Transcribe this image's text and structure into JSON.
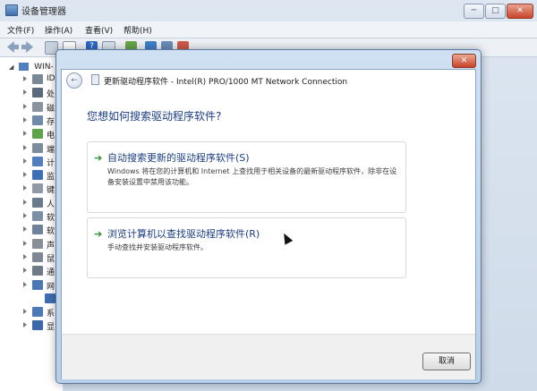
{
  "background_window": {
    "title": "设备管理器",
    "controls": {
      "minimize": "─",
      "maximize": "□",
      "close": "✕"
    },
    "menu": [
      "文件(F)",
      "操作(A)",
      "查看(V)",
      "帮助(H)"
    ],
    "toolbar_help": "?",
    "tree": {
      "root_label": "WIN-",
      "root_expander": "◢",
      "items": [
        {
          "label": "ID",
          "icon": "ide-controller-icon",
          "color": "#7a8796"
        },
        {
          "label": "处",
          "icon": "processor-icon",
          "color": "#5a6a7c"
        },
        {
          "label": "磁",
          "icon": "disk-drive-icon",
          "color": "#8a949f"
        },
        {
          "label": "存",
          "icon": "storage-controller-icon",
          "color": "#6f8aa8"
        },
        {
          "label": "电",
          "icon": "power-battery-icon",
          "color": "#5fa34a"
        },
        {
          "label": "端",
          "icon": "port-icon",
          "color": "#7c8c9c"
        },
        {
          "label": "计",
          "icon": "computer-icon",
          "color": "#4f7fbf"
        },
        {
          "label": "监",
          "icon": "monitor-icon",
          "color": "#3d6fb4"
        },
        {
          "label": "键",
          "icon": "keyboard-icon",
          "color": "#8f9aa6"
        },
        {
          "label": "人",
          "icon": "human-interface-icon",
          "color": "#6a7b8d"
        },
        {
          "label": "软",
          "icon": "software-device-icon",
          "color": "#7c8fa6"
        },
        {
          "label": "软",
          "icon": "software-component-icon",
          "color": "#6e829a"
        },
        {
          "label": "声",
          "icon": "sound-icon",
          "color": "#8a8f96"
        },
        {
          "label": "鼠",
          "icon": "mouse-icon",
          "color": "#7e8894"
        },
        {
          "label": "通",
          "icon": "usb-controller-icon",
          "color": "#6d7a88"
        },
        {
          "label": "网",
          "icon": "network-adapter-icon",
          "color": "#4a78b5"
        },
        {
          "label": "",
          "icon": "network-card-icon",
          "color": "#3f6fb0"
        },
        {
          "label": "系",
          "icon": "system-device-icon",
          "color": "#4d7ab6"
        },
        {
          "label": "显",
          "icon": "display-adapter-icon",
          "color": "#3b68a8"
        }
      ]
    }
  },
  "dialog": {
    "close": "✕",
    "back_glyph": "←",
    "title": "更新驱动程序软件 - Intel(R) PRO/1000 MT Network Connection",
    "question": "您想如何搜索驱动程序软件?",
    "options": [
      {
        "arrow": "➔",
        "heading": "自动搜索更新的驱动程序软件(S)",
        "description": "Windows 将在您的计算机和 Internet 上查找用于相关设备的最新驱动程序软件，除非在设备安装设置中禁用该功能。"
      },
      {
        "arrow": "➔",
        "heading": "浏览计算机以查找驱动程序软件(R)",
        "description": "手动查找并安装驱动程序软件。"
      }
    ],
    "cancel": "取消"
  }
}
